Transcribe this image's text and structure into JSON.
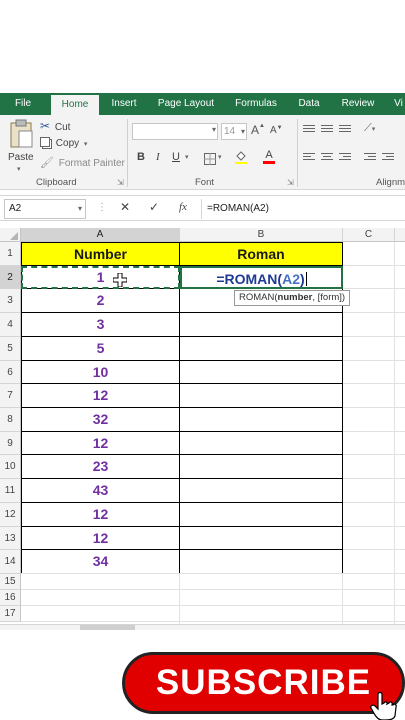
{
  "ribbon": {
    "tabs": [
      {
        "label": "File",
        "active": false
      },
      {
        "label": "Home",
        "active": true
      },
      {
        "label": "Insert",
        "active": false
      },
      {
        "label": "Page Layout",
        "active": false
      },
      {
        "label": "Formulas",
        "active": false
      },
      {
        "label": "Data",
        "active": false
      },
      {
        "label": "Review",
        "active": false
      },
      {
        "label": "Vi",
        "active": false
      }
    ],
    "clipboard": {
      "paste_label": "Paste",
      "cut_label": "Cut",
      "copy_label": "Copy",
      "format_painter_label": "Format Painter",
      "group_label": "Clipboard"
    },
    "font": {
      "font_size_value": "14",
      "bold_label": "B",
      "italic_label": "I",
      "underline_label": "U",
      "grow_label": "A",
      "shrink_label": "A",
      "color_label": "A",
      "group_label": "Font"
    },
    "alignment": {
      "group_label": "Alignm"
    }
  },
  "formula_bar": {
    "name_box": "A2",
    "cancel_label": "✕",
    "enter_label": "✓",
    "fx_label": "fx",
    "formula": "=ROMAN(A2)"
  },
  "grid": {
    "columns": [
      "A",
      "B",
      "C"
    ],
    "rows": [
      "1",
      "2",
      "3",
      "4",
      "5",
      "6",
      "7",
      "8",
      "9",
      "10",
      "11",
      "12",
      "13",
      "14",
      "15",
      "16",
      "17"
    ],
    "header": [
      "Number",
      "Roman"
    ],
    "values": [
      "1",
      "2",
      "3",
      "5",
      "10",
      "12",
      "32",
      "12",
      "23",
      "43",
      "12",
      "12",
      "34"
    ],
    "editing": {
      "prefix": "=ROMAN(",
      "ref": "A2",
      "suffix": ")"
    },
    "tooltip": {
      "prefix": "ROMAN(",
      "bold_arg": "number",
      "rest": ", [form])"
    }
  },
  "subscribe_label": "SUBSCRIBE",
  "colors": {
    "excel_green": "#217346",
    "header_fill": "#ffff00",
    "number_text": "#7030a0",
    "ref_blue": "#4472c4",
    "subscribe_red": "#e00000"
  }
}
